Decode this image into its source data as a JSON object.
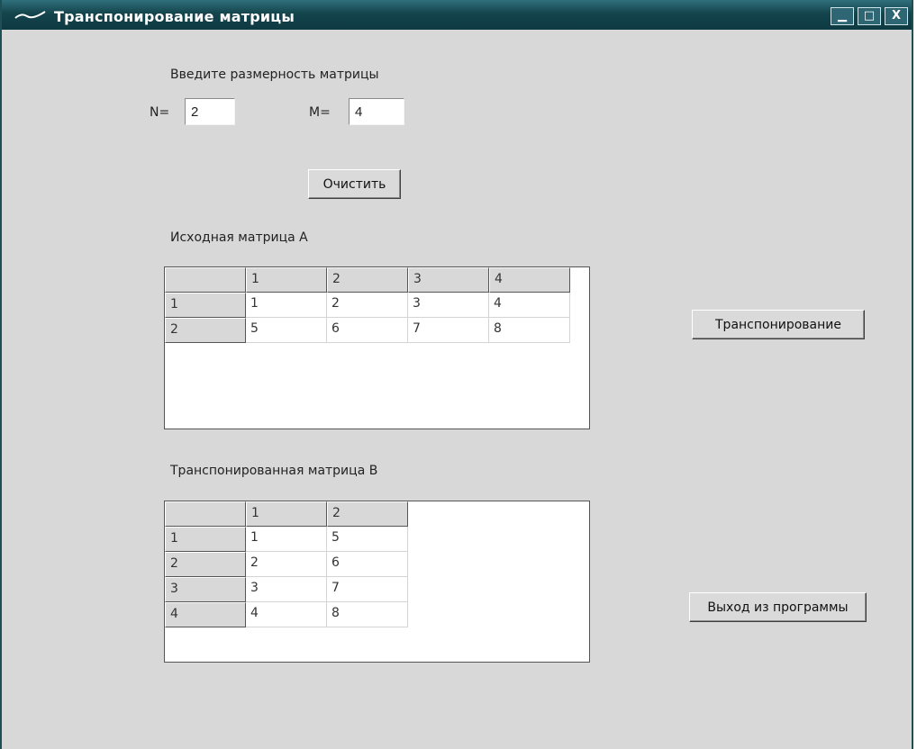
{
  "window": {
    "title": "Транспонирование матрицы",
    "minimize_glyph": "▁",
    "maximize_glyph": "□",
    "close_glyph": "X"
  },
  "dimensions": {
    "prompt": "Введите размерность матрицы",
    "n_label": "N=",
    "n_value": "2",
    "m_label": "M=",
    "m_value": "4"
  },
  "buttons": {
    "clear": "Очистить",
    "transpose": "Транспонирование",
    "exit": "Выход из программы"
  },
  "matrix_a": {
    "label": "Исходная матрица А",
    "col_headers": [
      "1",
      "2",
      "3",
      "4"
    ],
    "rows": [
      {
        "header": "1",
        "cells": [
          "1",
          "2",
          "3",
          "4"
        ]
      },
      {
        "header": "2",
        "cells": [
          "5",
          "6",
          "7",
          "8"
        ]
      }
    ]
  },
  "matrix_b": {
    "label": "Транспонированная матрица В",
    "col_headers": [
      "1",
      "2"
    ],
    "rows": [
      {
        "header": "1",
        "cells": [
          "1",
          "5"
        ]
      },
      {
        "header": "2",
        "cells": [
          "2",
          "6"
        ]
      },
      {
        "header": "3",
        "cells": [
          "3",
          "7"
        ]
      },
      {
        "header": "4",
        "cells": [
          "4",
          "8"
        ]
      }
    ]
  },
  "colors": {
    "titlebar": "#14444c",
    "window_bg": "#d8d8d8"
  }
}
